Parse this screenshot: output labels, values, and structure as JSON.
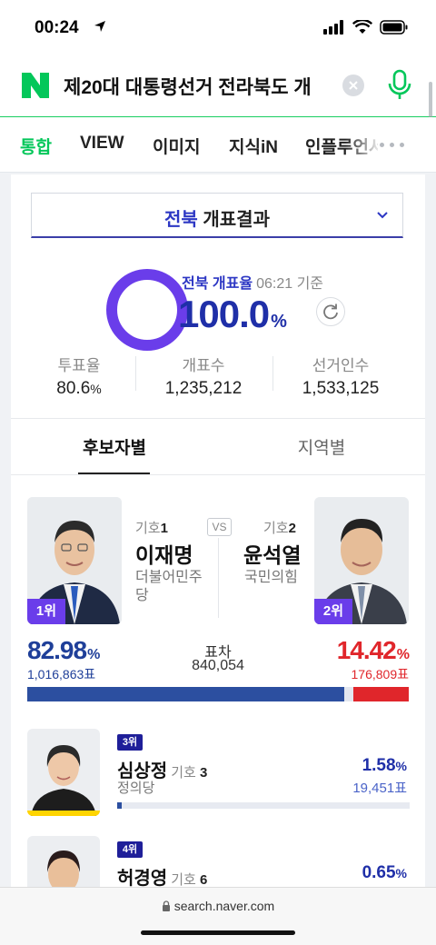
{
  "status": {
    "time": "00:24"
  },
  "search": {
    "query": "제20대 대통령선거 전라북도 개"
  },
  "tabs": [
    "통합",
    "VIEW",
    "이미지",
    "지식iN",
    "인플루언서"
  ],
  "region": {
    "name": "전북",
    "label": "개표결과"
  },
  "count": {
    "label_region": "전북",
    "label": "개표율",
    "time": "06:21 기준",
    "value": "100.0",
    "unit": "%"
  },
  "stats": [
    {
      "label": "투표율",
      "value": "80.6",
      "unit": "%"
    },
    {
      "label": "개표수",
      "value": "1,235,212"
    },
    {
      "label": "선거인수",
      "value": "1,533,125"
    }
  ],
  "subtabs": [
    "후보자별",
    "지역별"
  ],
  "top_candidates": [
    {
      "rank": "1위",
      "number_label": "기호",
      "number": "1",
      "name": "이재명",
      "party": "더불어민주당",
      "pct": "82.98",
      "pct_unit": "%",
      "votes": "1,016,863표",
      "color": "#2c4fa0"
    },
    {
      "rank": "2위",
      "number_label": "기호",
      "number": "2",
      "name": "윤석열",
      "party": "국민의힘",
      "pct": "14.42",
      "pct_unit": "%",
      "votes": "176,809표",
      "color": "#e0262b"
    }
  ],
  "vs_label": "VS",
  "gap": {
    "label": "표차",
    "value": "840,054"
  },
  "bar_share": {
    "blue": 0.8298,
    "red": 0.1442
  },
  "other_candidates": [
    {
      "rank": "3위",
      "name": "심상정",
      "number_label": "기호",
      "number": "3",
      "party": "정의당",
      "pct": "1.58",
      "pct_unit": "%",
      "votes": "19,451표",
      "share": 0.0158
    },
    {
      "rank": "4위",
      "name": "허경영",
      "number_label": "기호",
      "number": "6",
      "party": "",
      "pct": "0.65",
      "pct_unit": "%",
      "votes": "",
      "share": 0.0065
    }
  ],
  "url": "search.naver.com",
  "colors": {
    "accent": "#03c75a",
    "navy": "#1f2fa8",
    "purple": "#6a3dea",
    "red": "#e0262b"
  }
}
